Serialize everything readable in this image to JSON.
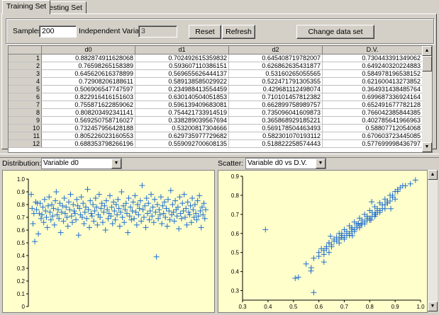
{
  "tabs": [
    {
      "label": "Training Set",
      "active": true
    },
    {
      "label": "Testing Set",
      "active": false
    }
  ],
  "controls": {
    "samples_label": "Samples:",
    "samples_value": "200",
    "indep_label": "Independent Variables:",
    "indep_value": "3",
    "reset_label": "Reset",
    "refresh_label": "Refresh",
    "change_label": "Change data set"
  },
  "table": {
    "columns": [
      "d0",
      "d1",
      "d2",
      "D.V."
    ],
    "rows": [
      [
        "1",
        "0.882874911628068",
        "0.702492615359832",
        "0.645408719782007",
        "0.730443391349062"
      ],
      [
        "2",
        "0.76598265158389",
        "0.593607110386151",
        "0.626862635431877",
        "0.649240320224883"
      ],
      [
        "3",
        "0.645620616378899",
        "0.569655626444137",
        "0.53160265055565",
        "0.584978196538152"
      ],
      [
        "4",
        "0.72908206188611",
        "0.589138585029922",
        "0.522471791305355",
        "0.621600413273852"
      ],
      [
        "5",
        "0.506906547747597",
        "0.234988413554459",
        "0.429681112498074",
        "0.364931438485764"
      ],
      [
        "6",
        "0.822916416151603",
        "0.630140504051853",
        "0.710101457812382",
        "0.699687336924164"
      ],
      [
        "7",
        "0.755871622859062",
        "0.596139409683081",
        "0.662899758989757",
        "0.652491677782128"
      ],
      [
        "8",
        "0.808203492341141",
        "0.754421733914519",
        "0.735096041609873",
        "0.766042385844385"
      ],
      [
        "9",
        "0.569250758716027",
        "0.338289039567694",
        "0.365868929185221",
        "0.402785641966963"
      ],
      [
        "10",
        "0.732457956428188",
        "0.53200817304666",
        "0.569178504463493",
        "0.58807712054068"
      ],
      [
        "11",
        "0.805226023160553",
        "0.629735977729682",
        "0.582301070193112",
        "0.670603723445085"
      ],
      [
        "12",
        "0.688353798266196",
        "0.559092700608135",
        "0.518822258574443",
        "0.577699998436797"
      ]
    ]
  },
  "distribution": {
    "label": "Distribution:",
    "selected": "Variable d0"
  },
  "scatter": {
    "label": "Scatter:",
    "selected": "Variable d0 vs D.V."
  },
  "chart_data": [
    {
      "type": "scatter",
      "title": "",
      "xlabel": "",
      "ylabel": "",
      "ylim": [
        0,
        1.0
      ],
      "yticks": [
        "0",
        "0.1",
        "0.2",
        "0.3",
        "0.4",
        "0.5",
        "0.6",
        "0.7",
        "0.8",
        "0.9",
        "1.0"
      ],
      "grid": false,
      "marker": "+",
      "color": "#1f6fd0",
      "note_points": "d0 value per sample index",
      "y": [
        0.88,
        0.77,
        0.65,
        0.73,
        0.51,
        0.82,
        0.76,
        0.81,
        0.57,
        0.73,
        0.81,
        0.69,
        0.72,
        0.78,
        0.66,
        0.84,
        0.75,
        0.7,
        0.62,
        0.79,
        0.86,
        0.74,
        0.68,
        0.8,
        0.71,
        0.77,
        0.64,
        0.83,
        0.9,
        0.72,
        0.76,
        0.69,
        0.81,
        0.58,
        0.74,
        0.79,
        0.67,
        0.85,
        0.73,
        0.78,
        0.7,
        0.63,
        0.82,
        0.76,
        0.88,
        0.71,
        0.66,
        0.8,
        0.75,
        0.73,
        0.68,
        0.84,
        0.79,
        0.56,
        0.77,
        0.72,
        0.86,
        0.7,
        0.81,
        0.65,
        0.74,
        0.78,
        0.69,
        0.92,
        0.76,
        0.62,
        0.83,
        0.73,
        0.71,
        0.8,
        0.67,
        0.75,
        0.85,
        0.78,
        0.64,
        0.72,
        0.88,
        0.7,
        0.77,
        0.81,
        0.66,
        0.74,
        0.79,
        0.6,
        0.83,
        0.76,
        0.69,
        0.73,
        0.87,
        0.71,
        0.78,
        0.65,
        0.82,
        0.75,
        0.68,
        0.8,
        0.72,
        0.84,
        0.77,
        0.63,
        0.74,
        0.9,
        0.7,
        0.79,
        0.66,
        0.76,
        0.81,
        0.73,
        0.58,
        0.85,
        0.71,
        0.78,
        0.68,
        0.75,
        0.82,
        0.69,
        0.87,
        0.74,
        0.64,
        0.8,
        0.72,
        0.77,
        0.83,
        0.67,
        0.95,
        0.76,
        0.7,
        0.79,
        0.62,
        0.85,
        0.73,
        0.81,
        0.68,
        0.75,
        0.88,
        0.71,
        0.78,
        0.66,
        0.84,
        0.74,
        0.39,
        0.8,
        0.69,
        0.76,
        0.72,
        0.86,
        0.65,
        0.79,
        0.73,
        0.82,
        0.7,
        0.77,
        0.63,
        0.84,
        0.75,
        0.68,
        0.91,
        0.72,
        0.8,
        0.74,
        0.67,
        0.83,
        0.76,
        0.71,
        0.78,
        0.61,
        0.86,
        0.73,
        0.69,
        0.81,
        0.75,
        0.88,
        0.7,
        0.77,
        0.64,
        0.82,
        0.74,
        0.72,
        0.79,
        0.66,
        0.85,
        0.76,
        0.7,
        0.8,
        0.73,
        0.68,
        0.83,
        0.71,
        0.87,
        0.75,
        0.62,
        0.78,
        0.72,
        0.81,
        0.69,
        0.76
      ]
    },
    {
      "type": "scatter",
      "title": "",
      "xlabel": "",
      "ylabel": "",
      "xlim": [
        0.3,
        1.0
      ],
      "ylim": [
        0.25,
        0.9
      ],
      "xticks": [
        "0.3",
        "0.4",
        "0.5",
        "0.6",
        "0.7",
        "0.8",
        "0.9",
        "1.0"
      ],
      "yticks": [
        "0.3",
        "0.4",
        "0.5",
        "0.6",
        "0.7",
        "0.8",
        "0.9"
      ],
      "grid": false,
      "marker": "+",
      "color": "#1f6fd0",
      "x": [
        0.883,
        0.766,
        0.646,
        0.729,
        0.507,
        0.823,
        0.756,
        0.808,
        0.569,
        0.732,
        0.805,
        0.688,
        0.39,
        0.52,
        0.55,
        0.58,
        0.6,
        0.61,
        0.62,
        0.63,
        0.64,
        0.65,
        0.66,
        0.67,
        0.68,
        0.69,
        0.7,
        0.71,
        0.72,
        0.73,
        0.74,
        0.75,
        0.76,
        0.77,
        0.78,
        0.79,
        0.8,
        0.81,
        0.82,
        0.83,
        0.84,
        0.85,
        0.86,
        0.87,
        0.88,
        0.89,
        0.9,
        0.91,
        0.92,
        0.94,
        0.96,
        0.98,
        0.62,
        0.64,
        0.66,
        0.68,
        0.7,
        0.72,
        0.74,
        0.76,
        0.78,
        0.8,
        0.82,
        0.84,
        0.86,
        0.69,
        0.71,
        0.73,
        0.75,
        0.77,
        0.79,
        0.81,
        0.83,
        0.85,
        0.87,
        0.89,
        0.63,
        0.67,
        0.71,
        0.75,
        0.79,
        0.83,
        0.87,
        0.91,
        0.6,
        0.65,
        0.7,
        0.74,
        0.78,
        0.82,
        0.86,
        0.9,
        0.93,
        0.57,
        0.64,
        0.68,
        0.72,
        0.76,
        0.8,
        0.84,
        0.88,
        0.58,
        0.62
      ],
      "y": [
        0.73,
        0.649,
        0.585,
        0.622,
        0.365,
        0.7,
        0.652,
        0.766,
        0.403,
        0.588,
        0.671,
        0.578,
        0.62,
        0.37,
        0.44,
        0.47,
        0.5,
        0.52,
        0.49,
        0.53,
        0.55,
        0.54,
        0.57,
        0.58,
        0.6,
        0.59,
        0.62,
        0.61,
        0.64,
        0.63,
        0.66,
        0.65,
        0.68,
        0.67,
        0.7,
        0.69,
        0.72,
        0.71,
        0.74,
        0.73,
        0.76,
        0.75,
        0.78,
        0.77,
        0.8,
        0.79,
        0.82,
        0.83,
        0.84,
        0.85,
        0.86,
        0.88,
        0.51,
        0.55,
        0.56,
        0.57,
        0.58,
        0.6,
        0.62,
        0.64,
        0.66,
        0.68,
        0.7,
        0.72,
        0.75,
        0.6,
        0.59,
        0.61,
        0.63,
        0.65,
        0.67,
        0.69,
        0.71,
        0.73,
        0.76,
        0.8,
        0.52,
        0.56,
        0.6,
        0.64,
        0.68,
        0.72,
        0.76,
        0.82,
        0.48,
        0.53,
        0.57,
        0.61,
        0.65,
        0.69,
        0.73,
        0.78,
        0.85,
        0.42,
        0.5,
        0.55,
        0.59,
        0.63,
        0.67,
        0.71,
        0.77,
        0.29,
        0.45
      ]
    }
  ]
}
